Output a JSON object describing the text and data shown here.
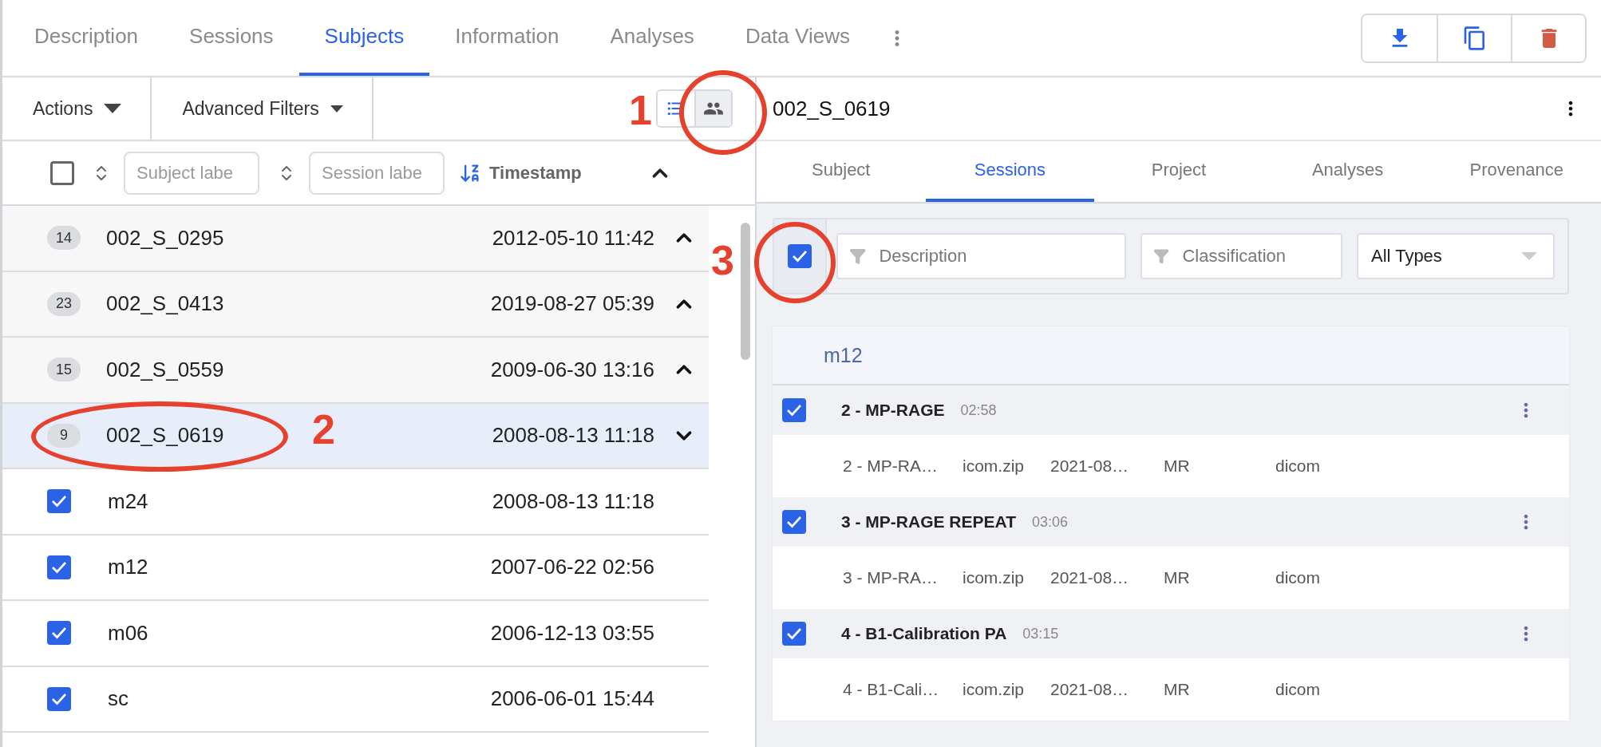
{
  "main_tabs": [
    {
      "label": "Description",
      "selected": false
    },
    {
      "label": "Sessions",
      "selected": false
    },
    {
      "label": "Subjects",
      "selected": true
    },
    {
      "label": "Information",
      "selected": false
    },
    {
      "label": "Analyses",
      "selected": false
    },
    {
      "label": "Data Views",
      "selected": false
    }
  ],
  "toolbar": {
    "actions": "Actions",
    "advanced_filters": "Advanced Filters",
    "view_toggle": [
      {
        "kind": "list",
        "selected": false
      },
      {
        "kind": "group",
        "selected": true
      }
    ]
  },
  "subject_header": {
    "checked": false,
    "subject_placeholder": "Subject labe",
    "session_placeholder": "Session labe",
    "sort_label": "Timestamp"
  },
  "subjects": [
    {
      "count": "14",
      "label": "002_S_0295",
      "timestamp": "2012-05-10 11:42",
      "selected": false,
      "expanded": false
    },
    {
      "count": "23",
      "label": "002_S_0413",
      "timestamp": "2019-08-27 05:39",
      "selected": false,
      "expanded": false
    },
    {
      "count": "15",
      "label": "002_S_0559",
      "timestamp": "2009-06-30 13:16",
      "selected": false,
      "expanded": false
    },
    {
      "count": "9",
      "label": "002_S_0619",
      "timestamp": "2008-08-13 11:18",
      "selected": true,
      "expanded": true,
      "children": [
        {
          "label": "m24",
          "timestamp": "2008-08-13 11:18",
          "checked": true
        },
        {
          "label": "m12",
          "timestamp": "2007-06-22 02:56",
          "checked": true
        },
        {
          "label": "m06",
          "timestamp": "2006-12-13 03:55",
          "checked": true
        },
        {
          "label": "sc",
          "timestamp": "2006-06-01 15:44",
          "checked": true
        }
      ]
    }
  ],
  "detail": {
    "title": "002_S_0619",
    "tabs": [
      {
        "label": "Subject",
        "selected": false
      },
      {
        "label": "Sessions",
        "selected": true
      },
      {
        "label": "Project",
        "selected": false
      },
      {
        "label": "Analyses",
        "selected": false
      },
      {
        "label": "Provenance",
        "selected": false
      }
    ],
    "filters": {
      "checked": true,
      "description_placeholder": "Description",
      "classification_placeholder": "Classification",
      "type_value": "All Types"
    },
    "session": {
      "label": "m12",
      "acquisitions": [
        {
          "title": "2 - MP-RAGE",
          "time": "02:58",
          "checked": true,
          "file": [
            "2 - MP-RA…",
            "icom.zip",
            "2021-08…",
            "MR",
            "dicom"
          ]
        },
        {
          "title": "3 - MP-RAGE REPEAT",
          "time": "03:06",
          "checked": true,
          "file": [
            "3 - MP-RA…",
            "icom.zip",
            "2021-08…",
            "MR",
            "dicom"
          ]
        },
        {
          "title": "4 - B1-Calibration PA",
          "time": "03:15",
          "checked": true,
          "file": [
            "4 - B1-Cali…",
            "icom.zip",
            "2021-08…",
            "MR",
            "dicom"
          ]
        }
      ]
    }
  },
  "annotations": [
    {
      "label": "1"
    },
    {
      "label": "2"
    },
    {
      "label": "3"
    }
  ]
}
